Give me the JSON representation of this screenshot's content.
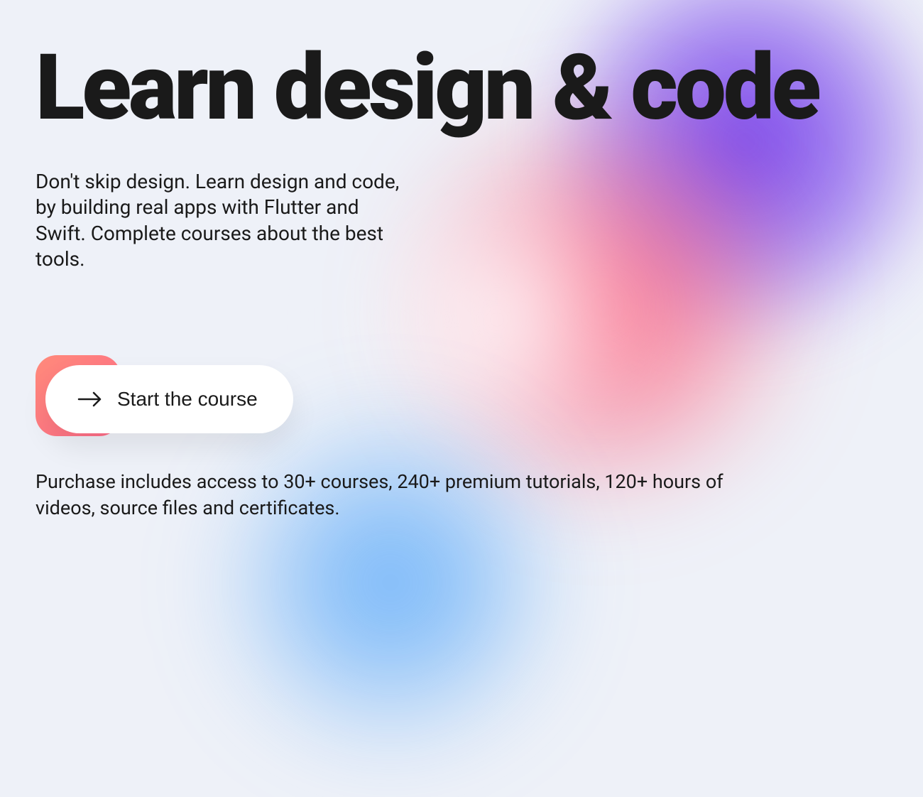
{
  "hero": {
    "headline": "Learn design & code",
    "description": "Don't skip design. Learn design and code, by building real apps with Flutter and Swift. Complete courses about the best tools."
  },
  "cta": {
    "label": "Start the course"
  },
  "footer": {
    "text": "Purchase includes access to 30+ courses, 240+ premium tutorials, 120+ hours of videos, source files and certificates."
  }
}
